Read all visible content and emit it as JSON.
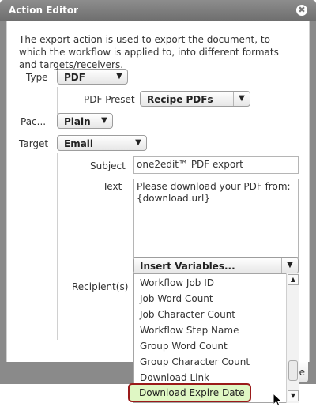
{
  "dialog": {
    "title": "Action Editor",
    "close_icon": "✖",
    "description": "The export action is used to export the document, to which the workflow is applied to, into different formats and targets/receivers.",
    "footer_button": "e"
  },
  "form": {
    "type_label": "Type",
    "type_value": "PDF",
    "preset_label": "PDF Preset",
    "preset_value": "Recipe PDFs",
    "pack_label": "Pac...",
    "pack_value": "Plain",
    "target_label": "Target",
    "target_value": "Email",
    "subject_label": "Subject",
    "subject_value": "one2edit™ PDF export",
    "text_label": "Text",
    "text_value": "Please download your PDF from:\n{download.url}",
    "insert_variables": "Insert Variables...",
    "recipients_label": "Recipient(s)",
    "arrow_glyph": "▼"
  },
  "dropdown": {
    "options": [
      "Workflow Job ID",
      "Job Word Count",
      "Job Character Count",
      "Workflow Step Name",
      "Group Word Count",
      "Group Character Count",
      "Download Link",
      "Download Expire Date"
    ],
    "highlighted": "Download Expire Date",
    "scroll_up": "▲",
    "scroll_down": "▼"
  }
}
